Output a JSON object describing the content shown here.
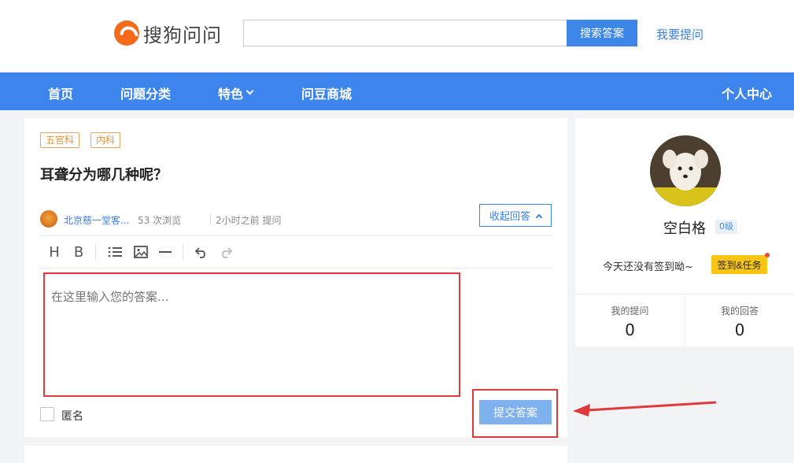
{
  "header": {
    "logo_text": "搜狗问问",
    "search_placeholder": "",
    "search_button": "搜索答案",
    "ask_link": "我要提问"
  },
  "nav": {
    "items": [
      "首页",
      "问题分类",
      "特色",
      "问豆商城"
    ],
    "profile": "个人中心"
  },
  "question": {
    "tags": [
      "五官科",
      "内科"
    ],
    "title": "耳聋分为哪几种呢？",
    "author": "北京慈一堂客...",
    "views": "53 次浏览",
    "asked": "2小时之前 提问",
    "collapse_label": "收起回答"
  },
  "editor": {
    "toolbar": [
      "heading-icon",
      "bold-icon",
      "list-icon",
      "image-icon",
      "hr-icon",
      "undo-icon",
      "redo-icon"
    ],
    "placeholder": "在这里输入您的答案...",
    "anonymous_label": "匿名",
    "submit_label": "提交答案"
  },
  "profile": {
    "name": "空白格",
    "level": "0级",
    "checkin_text": "今天还没有签到呦~",
    "checkin_button": "签到&任务",
    "stats": [
      {
        "label": "我的提问",
        "value": "0"
      },
      {
        "label": "我的回答",
        "value": "0"
      }
    ]
  },
  "colors": {
    "brand": "#3d85ec",
    "highlight_box": "#e0393b",
    "tag": "#e8913a"
  }
}
